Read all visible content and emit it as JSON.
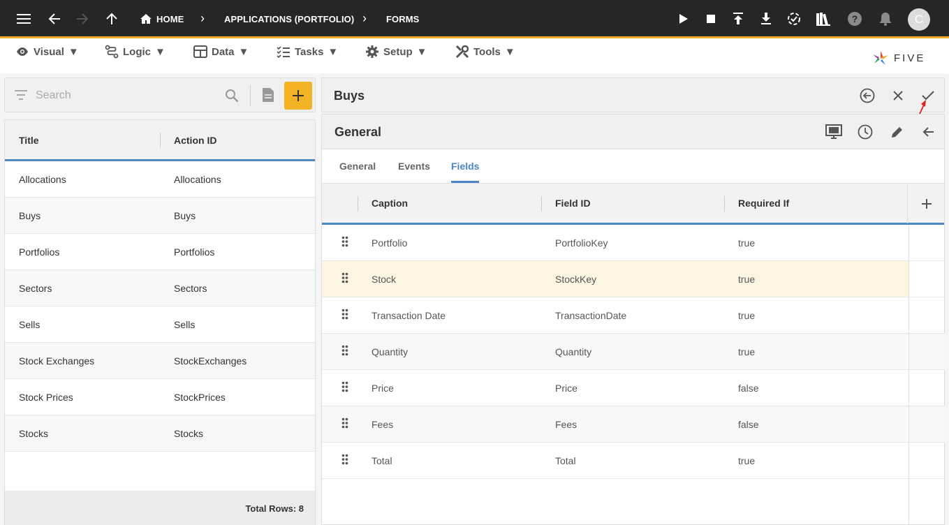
{
  "topbar": {
    "breadcrumbs": [
      "HOME",
      "APPLICATIONS (PORTFOLIO)",
      "FORMS"
    ],
    "avatar_letter": "C"
  },
  "menubar": {
    "items": [
      {
        "label": "Visual",
        "icon": "eye-icon"
      },
      {
        "label": "Logic",
        "icon": "logic-icon"
      },
      {
        "label": "Data",
        "icon": "table-icon"
      },
      {
        "label": "Tasks",
        "icon": "tasks-icon"
      },
      {
        "label": "Setup",
        "icon": "gear-icon"
      },
      {
        "label": "Tools",
        "icon": "tools-icon"
      }
    ],
    "logo_text": "FIVE"
  },
  "sidebar": {
    "search_placeholder": "Search",
    "columns": [
      "Title",
      "Action ID"
    ],
    "rows": [
      [
        "Allocations",
        "Allocations"
      ],
      [
        "Buys",
        "Buys"
      ],
      [
        "Portfolios",
        "Portfolios"
      ],
      [
        "Sectors",
        "Sectors"
      ],
      [
        "Sells",
        "Sells"
      ],
      [
        "Stock Exchanges",
        "StockExchanges"
      ],
      [
        "Stock Prices",
        "StockPrices"
      ],
      [
        "Stocks",
        "Stocks"
      ]
    ],
    "total_rows": "Total Rows: 8"
  },
  "form": {
    "title": "Buys",
    "section_title": "General",
    "tabs": [
      "General",
      "Events",
      "Fields"
    ],
    "active_tab": "Fields",
    "columns": [
      "Caption",
      "Field ID",
      "Required If"
    ],
    "rows": [
      [
        "Portfolio",
        "PortfolioKey",
        "true"
      ],
      [
        "Stock",
        "StockKey",
        "true"
      ],
      [
        "Transaction Date",
        "TransactionDate",
        "true"
      ],
      [
        "Quantity",
        "Quantity",
        "true"
      ],
      [
        "Price",
        "Price",
        "false"
      ],
      [
        "Fees",
        "Fees",
        "false"
      ],
      [
        "Total",
        "Total",
        "true"
      ]
    ],
    "selected_row": 1
  },
  "colors": {
    "accent_orange": "#f4ac25",
    "accent_blue": "#4a86c8",
    "topbar_bg": "#262626"
  }
}
